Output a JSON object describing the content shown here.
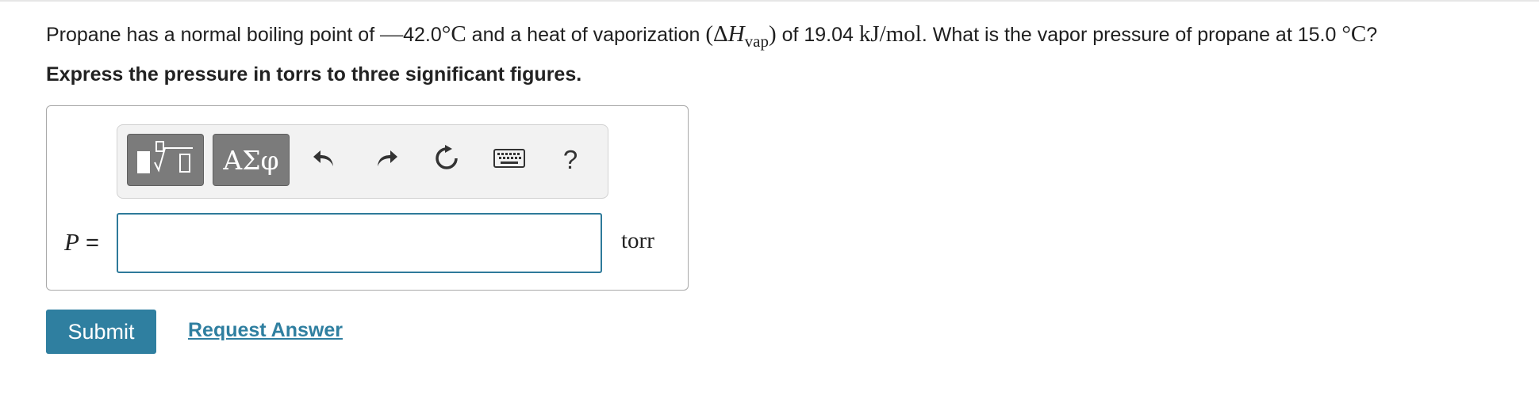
{
  "question": {
    "part1": "Propane has a normal boiling point of ",
    "minus": "—",
    "temp1": "42.0",
    "degree1": "°",
    "unit_c1": "C",
    "part2": " and a heat of vaporization ",
    "paren_open": "(",
    "delta": "Δ",
    "h": "H",
    "h_sub": "vap",
    "paren_close": ")",
    "part3": " of 19.04 ",
    "unit_kjmol": "kJ/mol",
    "part4": ". What is the vapor pressure of propane at 15.0 ",
    "degree2": "°",
    "unit_c2": "C",
    "qmark": "?"
  },
  "instruction": "Express the pressure in torrs to three significant figures.",
  "toolbar": {
    "template_icon": "templates-icon",
    "greek_label": "ΑΣφ",
    "undo_icon": "undo-icon",
    "redo_icon": "redo-icon",
    "reset_icon": "reset-icon",
    "keyboard_icon": "keyboard-icon",
    "help_label": "?"
  },
  "answer": {
    "variable": "P",
    "equals": " =",
    "value": "",
    "unit": "torr"
  },
  "actions": {
    "submit_label": "Submit",
    "request_label": "Request Answer"
  },
  "colors": {
    "accent": "#2f7fa0",
    "input_border": "#2e7a9a",
    "toolbar_button": "#7b7b7b"
  }
}
